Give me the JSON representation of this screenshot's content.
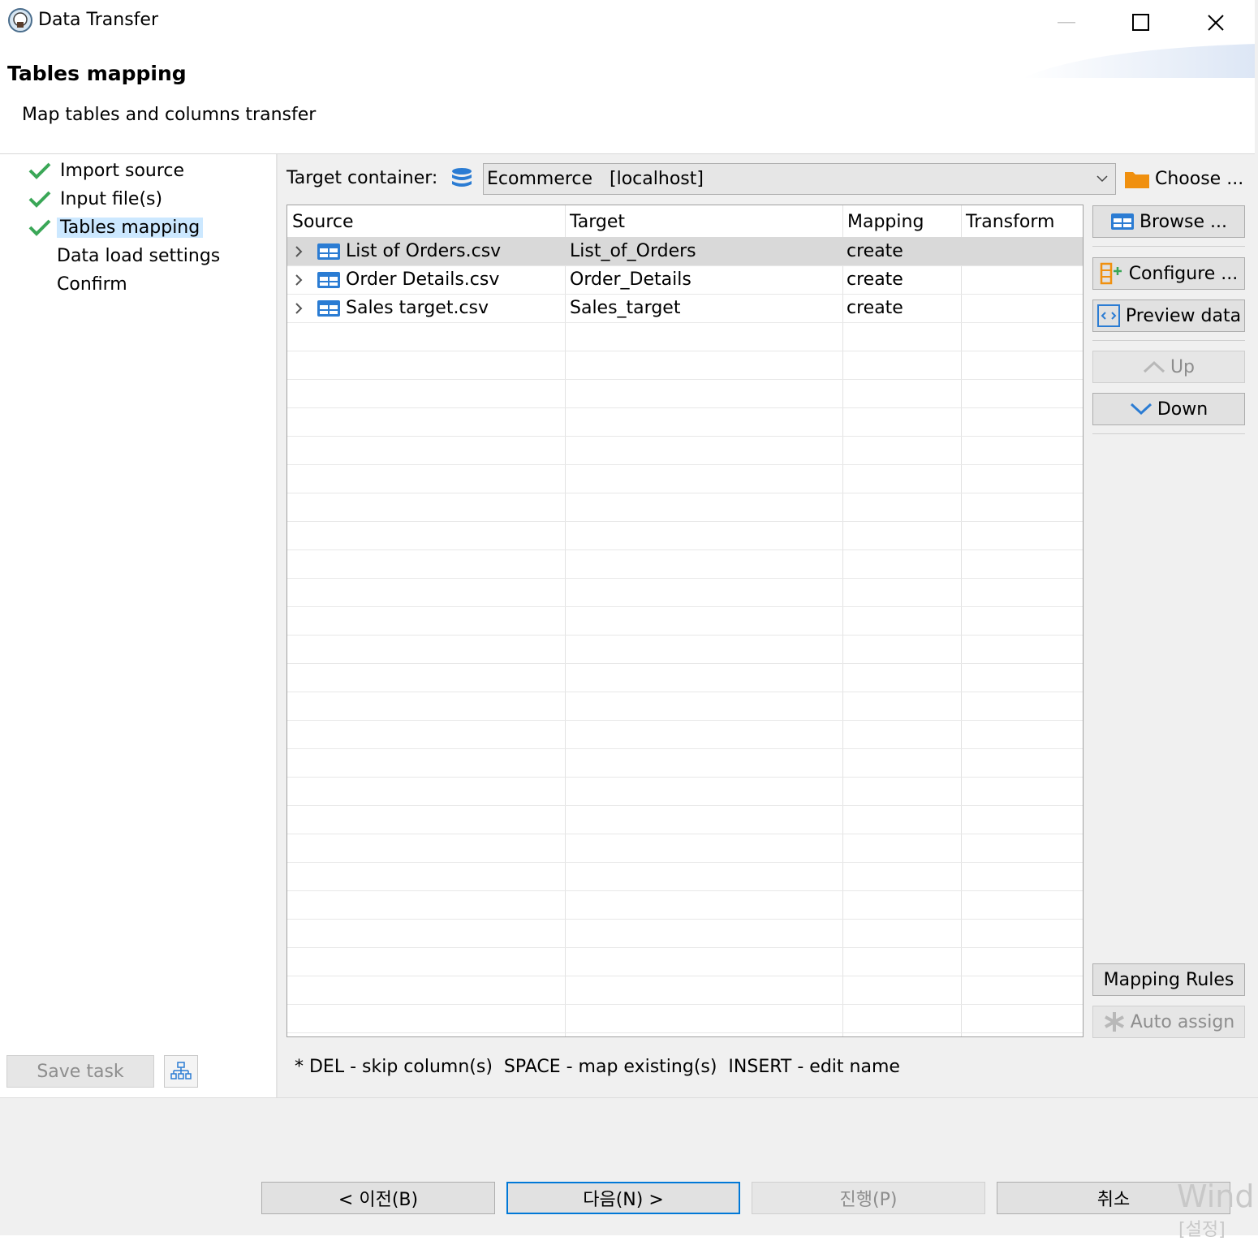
{
  "window": {
    "title": "Data Transfer"
  },
  "header": {
    "title": "Tables mapping",
    "subtitle": "Map tables and columns transfer"
  },
  "nav": {
    "items": [
      {
        "label": "Import source",
        "done": true,
        "active": false
      },
      {
        "label": "Input file(s)",
        "done": true,
        "active": false
      },
      {
        "label": "Tables mapping",
        "done": true,
        "active": true
      },
      {
        "label": "Data load settings",
        "done": false,
        "active": false
      },
      {
        "label": "Confirm",
        "done": false,
        "active": false
      }
    ],
    "save_task_label": "Save task"
  },
  "target": {
    "label": "Target container:",
    "value": "Ecommerce   [localhost]",
    "choose_label": "Choose ..."
  },
  "table": {
    "columns": [
      "Source",
      "Target",
      "Mapping",
      "Transform"
    ],
    "rows": [
      {
        "source": "List of Orders.csv",
        "target": "List_of_Orders",
        "mapping": "create",
        "transform": "",
        "selected": true
      },
      {
        "source": "Order Details.csv",
        "target": "Order_Details",
        "mapping": "create",
        "transform": "",
        "selected": false
      },
      {
        "source": "Sales target.csv",
        "target": "Sales_target",
        "mapping": "create",
        "transform": "",
        "selected": false
      }
    ]
  },
  "side_buttons": {
    "browse": "Browse ...",
    "configure": "Configure ...",
    "preview": "Preview data",
    "up": "Up",
    "down": "Down",
    "mapping_rules": "Mapping Rules",
    "auto_assign": "Auto assign"
  },
  "hint": "* DEL - skip column(s)  SPACE - map existing(s)  INSERT - edit name",
  "footer": {
    "back": "< 이전(B)",
    "next": "다음(N) >",
    "proceed": "진행(P)",
    "cancel": "취소"
  },
  "watermark": {
    "line1": "Wind",
    "line2": "[설정]"
  },
  "colors": {
    "accent": "#0078d7",
    "check": "#3aa757",
    "selection": "#cce8ff",
    "table_icon": "#2b7cd3",
    "folder": "#f0900f"
  }
}
